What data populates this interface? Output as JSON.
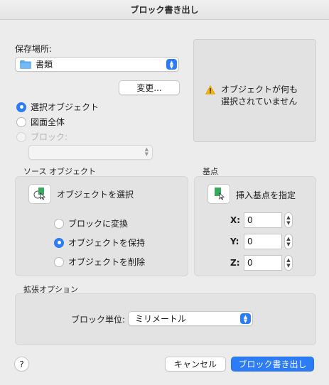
{
  "window": {
    "title": "ブロック書き出し"
  },
  "save_location": {
    "label": "保存場所:",
    "selected": "書類",
    "change_button": "変更..."
  },
  "source_radios": [
    {
      "label": "選択オブジェクト",
      "selected": true
    },
    {
      "label": "図面全体",
      "selected": false
    },
    {
      "label": "ブロック:",
      "selected": false,
      "disabled": true
    }
  ],
  "block_select": {
    "value": ""
  },
  "preview": {
    "warning": "オブジェクトが何も選択されていません"
  },
  "source_objects": {
    "title": "ソース オブジェクト",
    "select_button": "オブジェクトを選択",
    "options": [
      {
        "label": "ブロックに変換",
        "selected": false
      },
      {
        "label": "オブジェクトを保持",
        "selected": true
      },
      {
        "label": "オブジェクトを削除",
        "selected": false
      }
    ]
  },
  "base_point": {
    "title": "基点",
    "pick_button": "挿入基点を指定",
    "x_label": "X:",
    "x_value": "0",
    "y_label": "Y:",
    "y_value": "0",
    "z_label": "Z:",
    "z_value": "0"
  },
  "extended_options": {
    "title": "拡張オプション",
    "units_label": "ブロック単位:",
    "units_value": "ミリメートル"
  },
  "footer": {
    "help": "?",
    "cancel": "キャンセル",
    "export": "ブロック書き出し"
  },
  "colors": {
    "accent": "#2b7cf6",
    "warning": "#f2b500",
    "object_green": "#3aa85c"
  }
}
